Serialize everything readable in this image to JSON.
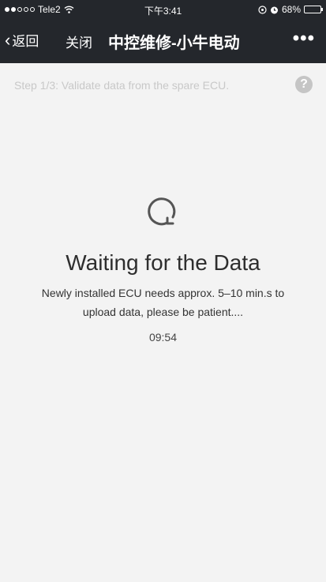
{
  "status_bar": {
    "carrier": "Tele2",
    "time": "下午3:41",
    "battery_percent": "68%"
  },
  "nav": {
    "back_label": "返回",
    "close_label": "关闭",
    "title": "中控维修-小牛电动",
    "more_label": "•••"
  },
  "step": {
    "text": "Step 1/3: Validate data from the spare ECU.",
    "help_glyph": "?"
  },
  "content": {
    "spinner_icon": "refresh-spinner-icon",
    "title": "Waiting for the Data",
    "message": "Newly installed ECU needs approx. 5–10 min.s to upload data, please be patient....",
    "timer": "09:54"
  }
}
